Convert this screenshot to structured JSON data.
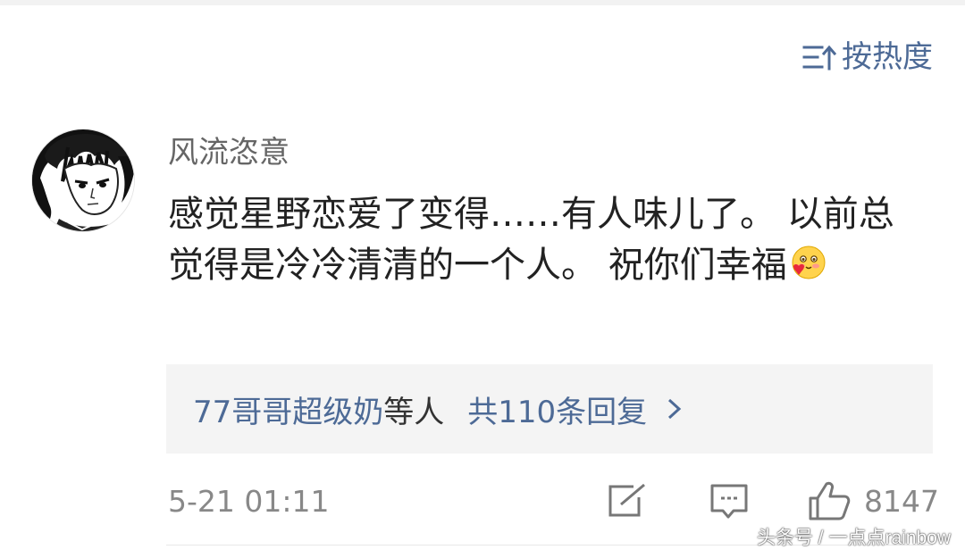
{
  "sort": {
    "label": "按热度",
    "icon": "sort-icon"
  },
  "comment": {
    "username": "风流恣意",
    "text": "感觉星野恋爱了变得……有人味儿了。 以前总觉得是冷冷清清的一个人。 祝你们幸福",
    "emoji": "smiling-face-with-heart-emoji",
    "avatar": "anime-character-avatar"
  },
  "replies": {
    "names": "77哥哥超级奶",
    "suffix": "等人",
    "count_text": "共110条回复",
    "chevron": "chevron-right-icon"
  },
  "footer": {
    "time": "5-21 01:11",
    "like_count": "8147",
    "icons": [
      "edit-icon",
      "comment-icon",
      "thumbs-up-icon"
    ]
  },
  "watermark": "头条号 / 一点点rainbow",
  "colors": {
    "link": "#4d6a96",
    "muted": "#888888",
    "text": "#222222",
    "reply_bg": "#f4f4f4"
  }
}
